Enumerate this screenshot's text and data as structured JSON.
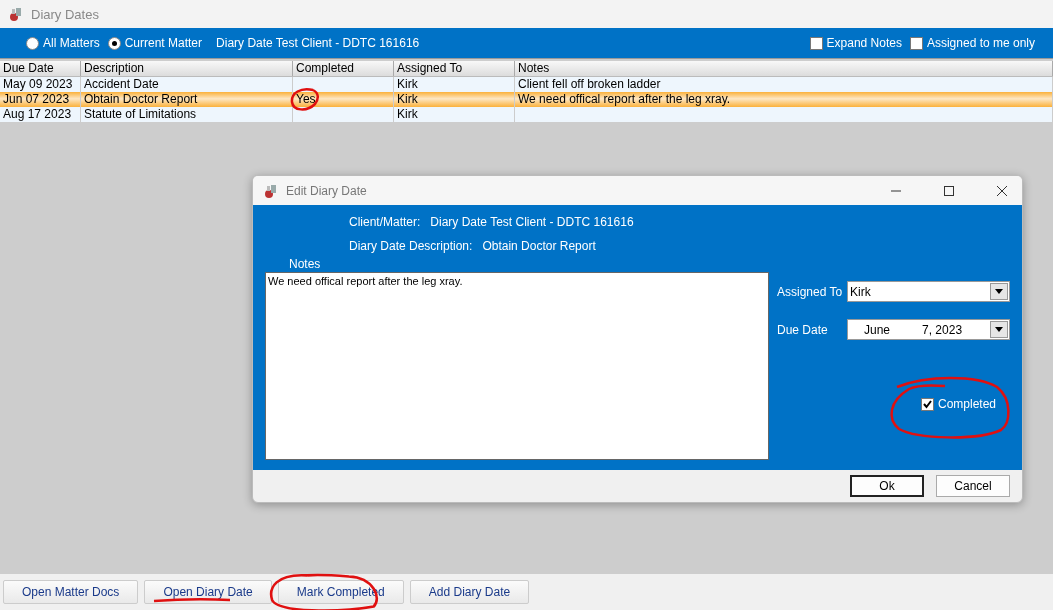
{
  "window": {
    "title": "Diary Dates"
  },
  "filter": {
    "scope_options": [
      {
        "label": "All Matters",
        "selected": false
      },
      {
        "label": "Current Matter",
        "selected": true
      }
    ],
    "matter": "Diary Date Test Client - DDTC 161616",
    "toggles": [
      {
        "label": "Expand Notes",
        "checked": false
      },
      {
        "label": "Assigned to me only",
        "checked": false
      }
    ]
  },
  "table": {
    "columns": [
      "Due Date",
      "Description",
      "Completed",
      "Assigned To",
      "Notes"
    ],
    "rows": [
      {
        "cells": [
          "May 09 2023",
          "Accident Date",
          "",
          "Kirk",
          "Client fell off broken ladder"
        ],
        "selected": false,
        "completed_circled": false
      },
      {
        "cells": [
          "Jun 07 2023",
          "Obtain Doctor Report",
          "Yes",
          "Kirk",
          "We need offical report after the leg xray."
        ],
        "selected": true,
        "completed_circled": true
      },
      {
        "cells": [
          "Aug 17 2023",
          "Statute of Limitations",
          "",
          "Kirk",
          ""
        ],
        "selected": false,
        "completed_circled": false
      }
    ]
  },
  "dialog": {
    "title": "Edit Diary Date",
    "client_label": "Client/Matter:",
    "client_value": "Diary Date Test Client - DDTC 161616",
    "description_label": "Diary Date Description:",
    "description_value": "Obtain Doctor Report",
    "notes_label": "Notes",
    "notes_value": "We need offical report after the leg xray.",
    "assigned_label": "Assigned To",
    "assigned_value": "Kirk",
    "due_label": "Due Date",
    "due_month": "June",
    "due_rest": "7, 2023",
    "completed": {
      "label": "Completed",
      "checked": true,
      "circled": true
    },
    "buttons": [
      "Ok",
      "Cancel"
    ]
  },
  "buttons": [
    {
      "label": "Open Matter Docs",
      "underlined": false,
      "circled": false
    },
    {
      "label": "Open Diary Date",
      "underlined": true,
      "circled": false
    },
    {
      "label": "Mark Completed",
      "underlined": false,
      "circled": true
    },
    {
      "label": "Add Diary Date",
      "underlined": false,
      "circled": false
    }
  ]
}
